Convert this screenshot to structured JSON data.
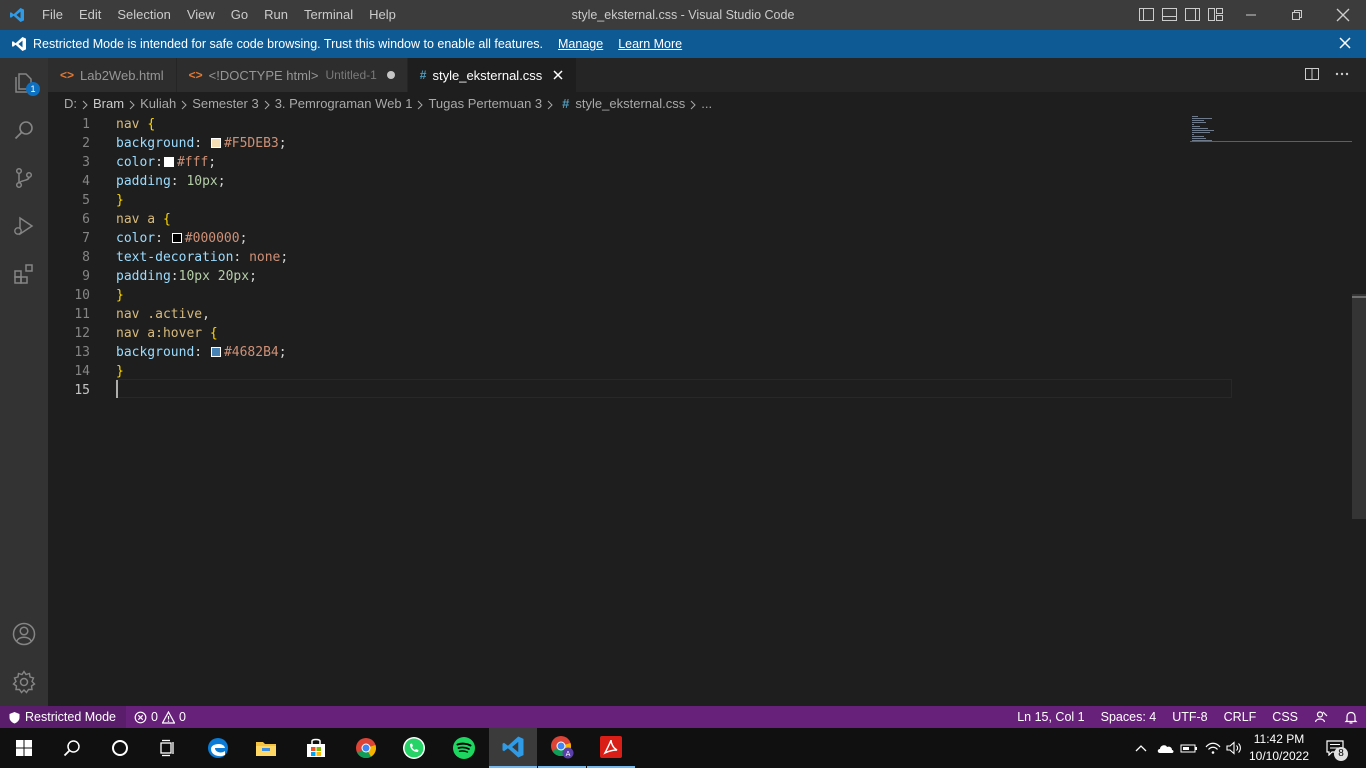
{
  "window": {
    "title": "style_eksternal.css - Visual Studio Code",
    "menu": [
      "File",
      "Edit",
      "Selection",
      "View",
      "Go",
      "Run",
      "Terminal",
      "Help"
    ]
  },
  "banner": {
    "message": "Restricted Mode is intended for safe code browsing. Trust this window to enable all features.",
    "manage_link": "Manage",
    "learn_more_link": "Learn More"
  },
  "activity_bar": {
    "explorer_badge": "1"
  },
  "tabs": [
    {
      "label": "Lab2Web.html",
      "icon": "<>",
      "active": false
    },
    {
      "label": "<!DOCTYPE html>",
      "description": "Untitled-1",
      "icon": "<>",
      "dirty": true,
      "active": false
    },
    {
      "label": "style_eksternal.css",
      "icon": "#",
      "active": true
    }
  ],
  "breadcrumb": {
    "items": [
      "D:",
      "Bram",
      "Kuliah",
      "Semester 3",
      "3. Pemrograman Web 1",
      "Tugas Pertemuan 3",
      "style_eksternal.css",
      "..."
    ]
  },
  "editor": {
    "lines": [
      {
        "n": "1",
        "t": [
          {
            "s": "sel",
            "v": "nav "
          },
          {
            "s": "brace",
            "v": "{"
          }
        ]
      },
      {
        "n": "2",
        "t": [
          {
            "s": "prop",
            "v": "background"
          },
          {
            "s": "punc",
            "v": ": "
          },
          {
            "swatch": "#F5DEB3"
          },
          {
            "s": "val",
            "v": "#F5DEB3"
          },
          {
            "s": "punc",
            "v": ";"
          }
        ]
      },
      {
        "n": "3",
        "t": [
          {
            "s": "prop",
            "v": "color"
          },
          {
            "s": "punc",
            "v": ":"
          },
          {
            "swatch": "#ffffff"
          },
          {
            "s": "val",
            "v": "#fff"
          },
          {
            "s": "punc",
            "v": ";"
          }
        ]
      },
      {
        "n": "4",
        "t": [
          {
            "s": "prop",
            "v": "padding"
          },
          {
            "s": "punc",
            "v": ": "
          },
          {
            "s": "num",
            "v": "10px"
          },
          {
            "s": "punc",
            "v": ";"
          }
        ]
      },
      {
        "n": "5",
        "t": [
          {
            "s": "brace",
            "v": "}"
          }
        ]
      },
      {
        "n": "6",
        "t": [
          {
            "s": "sel",
            "v": "nav a "
          },
          {
            "s": "brace",
            "v": "{"
          }
        ]
      },
      {
        "n": "7",
        "t": [
          {
            "s": "prop",
            "v": "color"
          },
          {
            "s": "punc",
            "v": ": "
          },
          {
            "swatch": "#000000"
          },
          {
            "s": "val",
            "v": "#000000"
          },
          {
            "s": "punc",
            "v": ";"
          }
        ]
      },
      {
        "n": "8",
        "t": [
          {
            "s": "prop",
            "v": "text-decoration"
          },
          {
            "s": "punc",
            "v": ": "
          },
          {
            "s": "val",
            "v": "none"
          },
          {
            "s": "punc",
            "v": ";"
          }
        ]
      },
      {
        "n": "9",
        "t": [
          {
            "s": "prop",
            "v": "padding"
          },
          {
            "s": "punc",
            "v": ":"
          },
          {
            "s": "num",
            "v": "10px 20px"
          },
          {
            "s": "punc",
            "v": ";"
          }
        ]
      },
      {
        "n": "10",
        "t": [
          {
            "s": "brace",
            "v": "}"
          }
        ]
      },
      {
        "n": "11",
        "t": [
          {
            "s": "sel",
            "v": "nav .active"
          },
          {
            "s": "punc",
            "v": ","
          }
        ]
      },
      {
        "n": "12",
        "t": [
          {
            "s": "sel",
            "v": "nav a:hover "
          },
          {
            "s": "brace",
            "v": "{"
          }
        ]
      },
      {
        "n": "13",
        "t": [
          {
            "s": "prop",
            "v": "background"
          },
          {
            "s": "punc",
            "v": ": "
          },
          {
            "swatch": "#4682B4"
          },
          {
            "s": "val",
            "v": "#4682B4"
          },
          {
            "s": "punc",
            "v": ";"
          }
        ]
      },
      {
        "n": "14",
        "t": [
          {
            "s": "brace",
            "v": "}"
          }
        ]
      },
      {
        "n": "15",
        "t": []
      }
    ]
  },
  "statusbar": {
    "restricted": "Restricted Mode",
    "errors": "0",
    "warnings": "0",
    "cursor": "Ln 15, Col 1",
    "spaces": "Spaces: 4",
    "encoding": "UTF-8",
    "eol": "CRLF",
    "language": "CSS"
  },
  "taskbar": {
    "time": "11:42 PM",
    "date": "10/10/2022",
    "notifications": "8"
  },
  "colors": {
    "titlebar": "#3c3c3c",
    "banner": "#0e5a94",
    "statusbar": "#68217a",
    "editor_bg": "#1e1e1e"
  }
}
